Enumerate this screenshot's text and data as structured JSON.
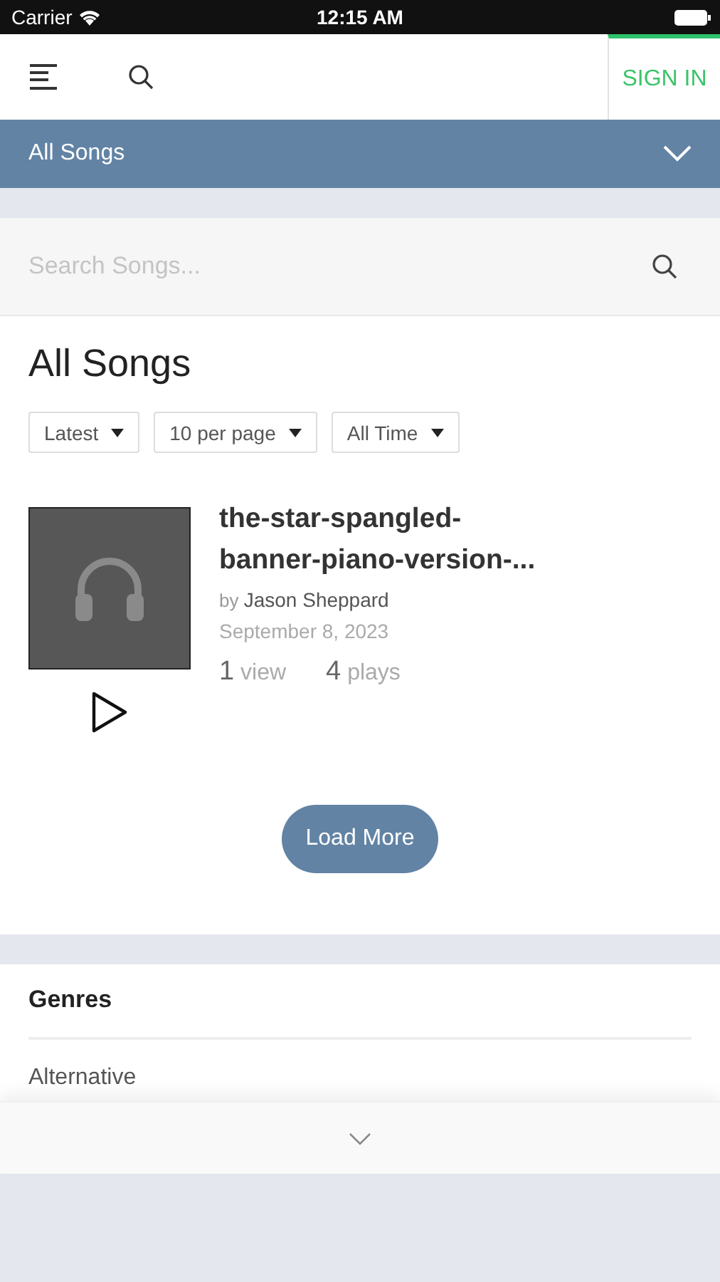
{
  "status_bar": {
    "carrier": "Carrier",
    "time": "12:15 AM"
  },
  "header": {
    "sign_in": "SIGN IN"
  },
  "section_bar": {
    "title": "All Songs"
  },
  "search": {
    "placeholder": "Search Songs..."
  },
  "page_title": "All Songs",
  "filters": [
    {
      "label": "Latest"
    },
    {
      "label": "10 per page"
    },
    {
      "label": "All Time"
    }
  ],
  "songs": [
    {
      "title": "the-star-spangled-banner-piano-version-...",
      "by": "by",
      "artist": "Jason Sheppard",
      "date": "September 8, 2023",
      "views": "1",
      "views_label": "view",
      "plays": "4",
      "plays_label": "plays"
    }
  ],
  "load_more": "Load More",
  "genres": {
    "title": "Genres",
    "items": [
      "Alternative"
    ]
  }
}
